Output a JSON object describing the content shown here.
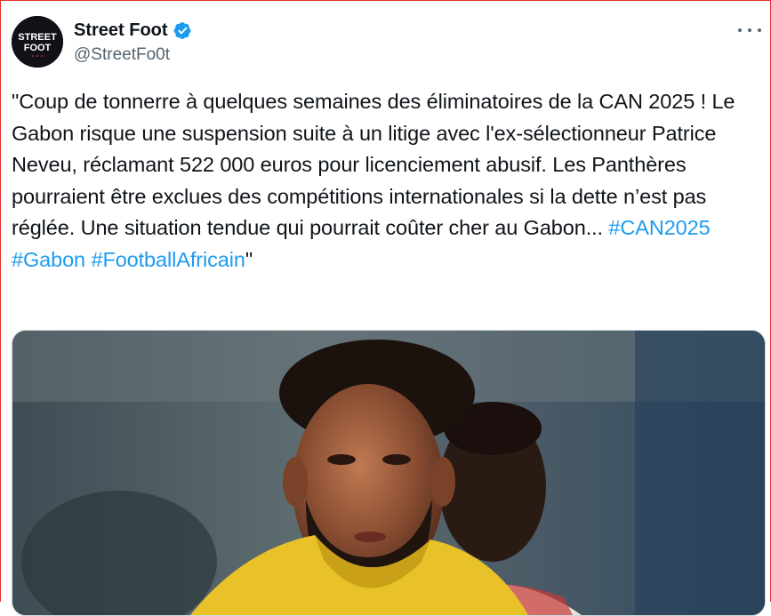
{
  "author": {
    "display_name": "Street Foot",
    "handle": "@StreetFo0t",
    "avatar_text_line1": "STREET",
    "avatar_text_line2": "FOOT",
    "verified": true
  },
  "tweet": {
    "text_main": "\"Coup de tonnerre à quelques semaines des éliminatoires de la CAN 2025 ! Le Gabon risque une suspension suite à un litige avec l'ex-sélectionneur Patrice Neveu, réclamant 522 000 euros pour licenciement abusif. Les Panthères pourraient être exclues des compétitions internationales si la dette n’est pas réglée. Une situation tendue qui pourrait coûter cher au Gabon... ",
    "hashtags": [
      "#CAN2025",
      "#Gabon",
      "#FootballAfricain"
    ],
    "text_end": "\""
  },
  "media": {
    "icon": "photo",
    "description": ""
  },
  "colors": {
    "accent": "#1d9bf0",
    "text": "#0f1419",
    "muted": "#536471"
  },
  "icons": {
    "verified": "verified-badge-icon",
    "more": "more-options-icon"
  }
}
